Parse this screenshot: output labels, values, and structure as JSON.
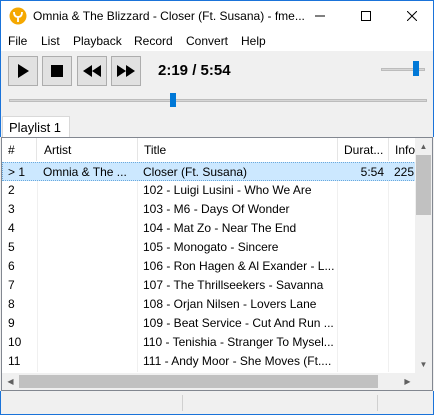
{
  "window": {
    "title": "Omnia & The Blizzard - Closer (Ft. Susana) - fme..."
  },
  "menu": [
    "File",
    "List",
    "Playback",
    "Record",
    "Convert",
    "Help"
  ],
  "player": {
    "time": "2:19 / 5:54",
    "seek_fraction": 0.39,
    "volume_fraction": 0.75
  },
  "tabs": [
    "Playlist 1"
  ],
  "playlist": {
    "columns": [
      "#",
      "Artist",
      "Title",
      "Durat...",
      "Info"
    ],
    "rows": [
      {
        "num": "> 1",
        "artist": "Omnia & The ...",
        "title": "Closer (Ft. Susana)",
        "duration": "5:54",
        "info": "225"
      },
      {
        "num": "2",
        "artist": "",
        "title": "102 - Luigi Lusini - Who We Are",
        "duration": "",
        "info": ""
      },
      {
        "num": "3",
        "artist": "",
        "title": "103 - M6 - Days Of Wonder",
        "duration": "",
        "info": ""
      },
      {
        "num": "4",
        "artist": "",
        "title": "104 - Mat Zo - Near The End",
        "duration": "",
        "info": ""
      },
      {
        "num": "5",
        "artist": "",
        "title": "105 - Monogato - Sincere",
        "duration": "",
        "info": ""
      },
      {
        "num": "6",
        "artist": "",
        "title": "106 - Ron Hagen & Al Exander - L...",
        "duration": "",
        "info": ""
      },
      {
        "num": "7",
        "artist": "",
        "title": "107 - The Thrillseekers - Savanna",
        "duration": "",
        "info": ""
      },
      {
        "num": "8",
        "artist": "",
        "title": "108 - Orjan Nilsen - Lovers Lane",
        "duration": "",
        "info": ""
      },
      {
        "num": "9",
        "artist": "",
        "title": "109 - Beat Service - Cut And Run ...",
        "duration": "",
        "info": ""
      },
      {
        "num": "10",
        "artist": "",
        "title": "110 - Tenishia - Stranger To Mysel...",
        "duration": "",
        "info": ""
      },
      {
        "num": "11",
        "artist": "",
        "title": "111 - Andy Moor - She Moves (Ft....",
        "duration": "",
        "info": ""
      }
    ]
  },
  "colors": {
    "accent": "#0078d7",
    "selection": "#cce8ff",
    "border": "#1a73d9"
  },
  "icons": [
    "app-logo-icon",
    "minimize-icon",
    "maximize-icon",
    "close-icon",
    "play-icon",
    "stop-icon",
    "rewind-icon",
    "fast-forward-icon"
  ]
}
